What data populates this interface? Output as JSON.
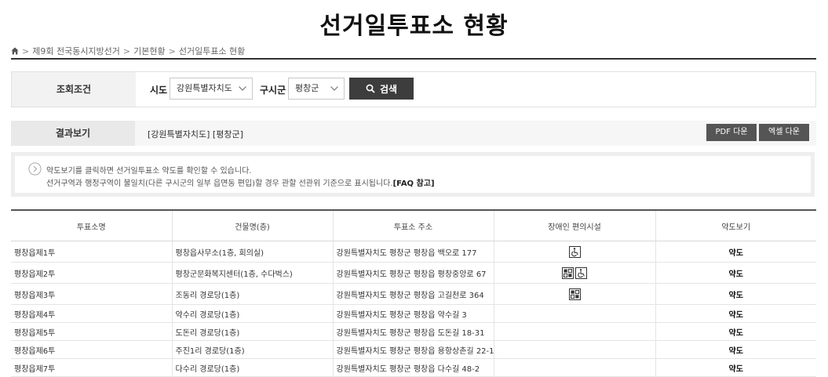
{
  "page_title": "선거일투표소 현황",
  "breadcrumb": {
    "items": [
      "제9회 전국동시지방선거",
      "기본현황",
      "선거일투표소 현황"
    ],
    "separator": ">"
  },
  "search": {
    "label": "조회조건",
    "sido_label": "시도",
    "sido_value": "강원특별자치도",
    "sigungu_label": "구시군",
    "sigungu_value": "평창군",
    "button_label": "검색"
  },
  "result": {
    "label": "결과보기",
    "region_text": "[강원특별자치도] [평창군]",
    "pdf_button": "PDF 다운",
    "excel_button": "엑셀 다운"
  },
  "notice": {
    "line1": "약도보기를 클릭하면 선거일투표소 약도를 확인할 수 있습니다.",
    "line2": "선거구역과 행정구역이 불일치(다른 구시군의 일부 읍면동 편입)할 경우 관할 선관위 기준으로 표시됩니다.",
    "faq": "[FAQ 참고]"
  },
  "table": {
    "headers": [
      "투표소명",
      "건물명(층)",
      "투표소 주소",
      "장애인 편의시설",
      "약도보기"
    ],
    "rows": [
      {
        "name": "평창읍제1투",
        "building": "평창읍사무소(1층, 회의실)",
        "address": "강원특별자치도 평창군 평창읍 백오로 177",
        "facilities": [
          "wheelchair-icon"
        ],
        "map": "약도"
      },
      {
        "name": "평창읍제2투",
        "building": "평창군문화복지센터(1층, 수다벅스)",
        "address": "강원특별자치도 평창군 평창읍 평창중앙로 67",
        "facilities": [
          "facility-grid-icon",
          "wheelchair-icon"
        ],
        "map": "약도"
      },
      {
        "name": "평창읍제3투",
        "building": "조동리 경로당(1층)",
        "address": "강원특별자치도 평창군 평창읍 고길천로 364",
        "facilities": [
          "facility-grid-icon"
        ],
        "map": "약도"
      },
      {
        "name": "평창읍제4투",
        "building": "약수리 경로당(1층)",
        "address": "강원특별자치도 평창군 평창읍 약수길 3",
        "facilities": [],
        "map": "약도"
      },
      {
        "name": "평창읍제5투",
        "building": "도돈리 경로당(1층)",
        "address": "강원특별자치도 평창군 평창읍 도돈길 18-31",
        "facilities": [],
        "map": "약도"
      },
      {
        "name": "평창읍제6투",
        "building": "주진1리 경로당(1층)",
        "address": "강원특별자치도 평창군 평창읍 용항상촌길 22-1",
        "facilities": [],
        "map": "약도"
      },
      {
        "name": "평창읍제7투",
        "building": "다수리 경로당(1층)",
        "address": "강원특별자치도 평창군 평창읍 다수길 48-2",
        "facilities": [],
        "map": "약도"
      }
    ]
  },
  "colors": {
    "dark_button": "#3d3d3d",
    "download_button": "#555555",
    "label_bg": "#f2f2f2"
  }
}
